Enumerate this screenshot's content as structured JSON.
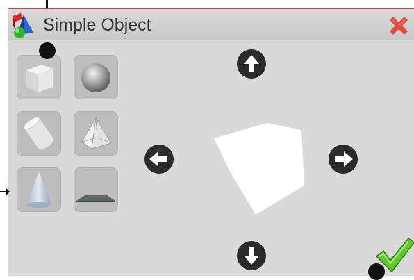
{
  "window": {
    "title": "Simple Object"
  },
  "icons": {
    "app": "app-shapes-icon",
    "close": "close-icon",
    "confirm": "checkmark-icon",
    "arrow_up": "arrow-up-icon",
    "arrow_down": "arrow-down-icon",
    "arrow_left": "arrow-left-icon",
    "arrow_right": "arrow-right-icon"
  },
  "shapes": [
    "cube",
    "sphere",
    "cylinder",
    "pyramid",
    "cone",
    "plane"
  ],
  "selected_shape": "cube",
  "colors": {
    "close": "#e04a3f",
    "confirm": "#5dcb2c",
    "panel": "#d9d9d9"
  }
}
